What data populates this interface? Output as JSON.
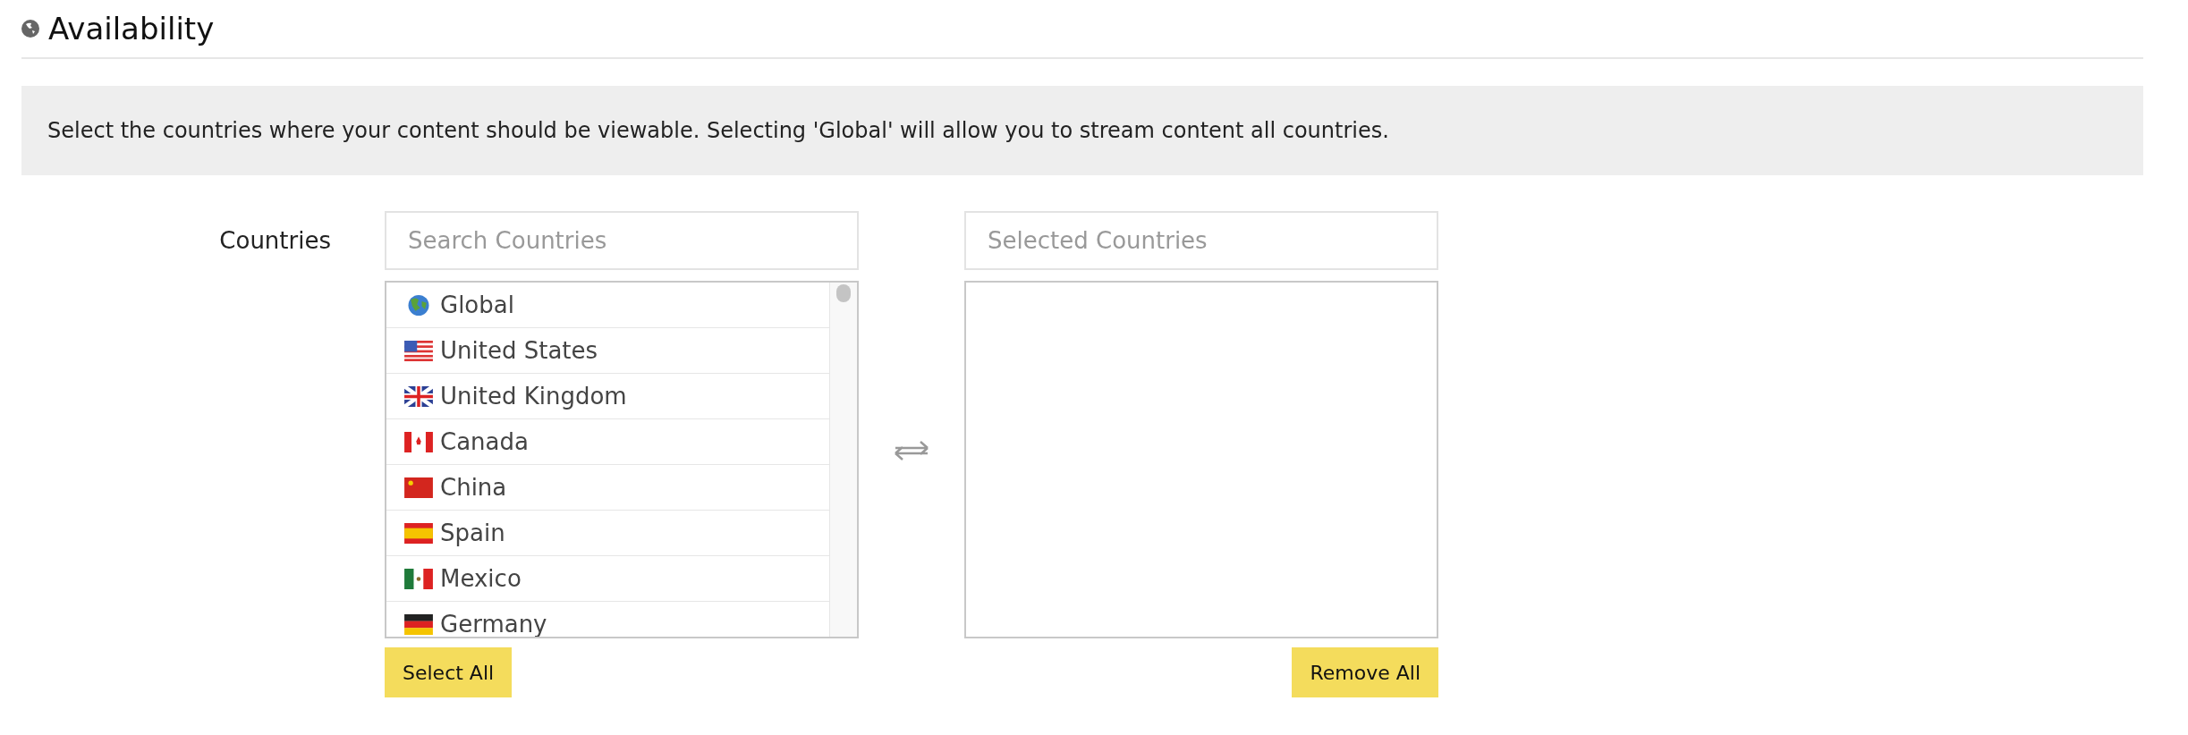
{
  "section": {
    "title": "Availability"
  },
  "info": "Select the countries where your content should be viewable. Selecting 'Global' will allow you to stream content all countries.",
  "field_label": "Countries",
  "search": {
    "placeholder": "Search Countries"
  },
  "countries": [
    {
      "name": "Global",
      "kind": "globe"
    },
    {
      "name": "United States",
      "kind": "us"
    },
    {
      "name": "United Kingdom",
      "kind": "uk"
    },
    {
      "name": "Canada",
      "kind": "ca"
    },
    {
      "name": "China",
      "kind": "cn"
    },
    {
      "name": "Spain",
      "kind": "es"
    },
    {
      "name": "Mexico",
      "kind": "mx"
    },
    {
      "name": "Germany",
      "kind": "de"
    }
  ],
  "selected_field": {
    "placeholder": "Selected Countries"
  },
  "buttons": {
    "select_all": "Select All",
    "remove_all": "Remove All"
  }
}
